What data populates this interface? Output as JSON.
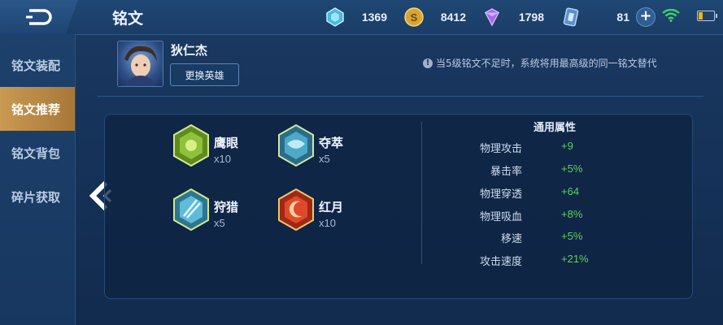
{
  "header": {
    "title": "铭文"
  },
  "resources": [
    {
      "name": "diamond",
      "value": "1369",
      "icon": "diamond-icon",
      "color": "#7fd7f0"
    },
    {
      "name": "gold",
      "value": "8412",
      "icon": "gold-coin-icon",
      "color": "#e2b23c"
    },
    {
      "name": "gem",
      "value": "1798",
      "icon": "purple-gem-icon",
      "color": "#b27cf2"
    },
    {
      "name": "coupon",
      "value": "81",
      "icon": "coupon-icon",
      "color": "#6f9fd8"
    }
  ],
  "battery_level": 0.25,
  "sidebar": {
    "items": [
      {
        "label": "铭文装配",
        "active": false
      },
      {
        "label": "铭文推荐",
        "active": true
      },
      {
        "label": "铭文背包",
        "active": false
      },
      {
        "label": "碎片获取",
        "active": false
      }
    ]
  },
  "hero": {
    "name": "狄仁杰",
    "change_label": "更换英雄"
  },
  "notice": "当5级铭文不足时，系统将用最高级的同一铭文替代",
  "runes": [
    {
      "name": "鹰眼",
      "count": "x10",
      "color": "#8fc13a"
    },
    {
      "name": "夺萃",
      "count": "x5",
      "color": "#4da9c9"
    },
    {
      "name": "狩猎",
      "count": "x5",
      "color": "#5fbcd8"
    },
    {
      "name": "红月",
      "count": "x10",
      "color": "#e04a2a"
    }
  ],
  "attributes": {
    "title": "通用属性",
    "rows": [
      {
        "label": "物理攻击",
        "value": "+9"
      },
      {
        "label": "暴击率",
        "value": "+5%"
      },
      {
        "label": "物理穿透",
        "value": "+64"
      },
      {
        "label": "物理吸血",
        "value": "+8%"
      },
      {
        "label": "移速",
        "value": "+5%"
      },
      {
        "label": "攻击速度",
        "value": "+21%"
      }
    ]
  }
}
